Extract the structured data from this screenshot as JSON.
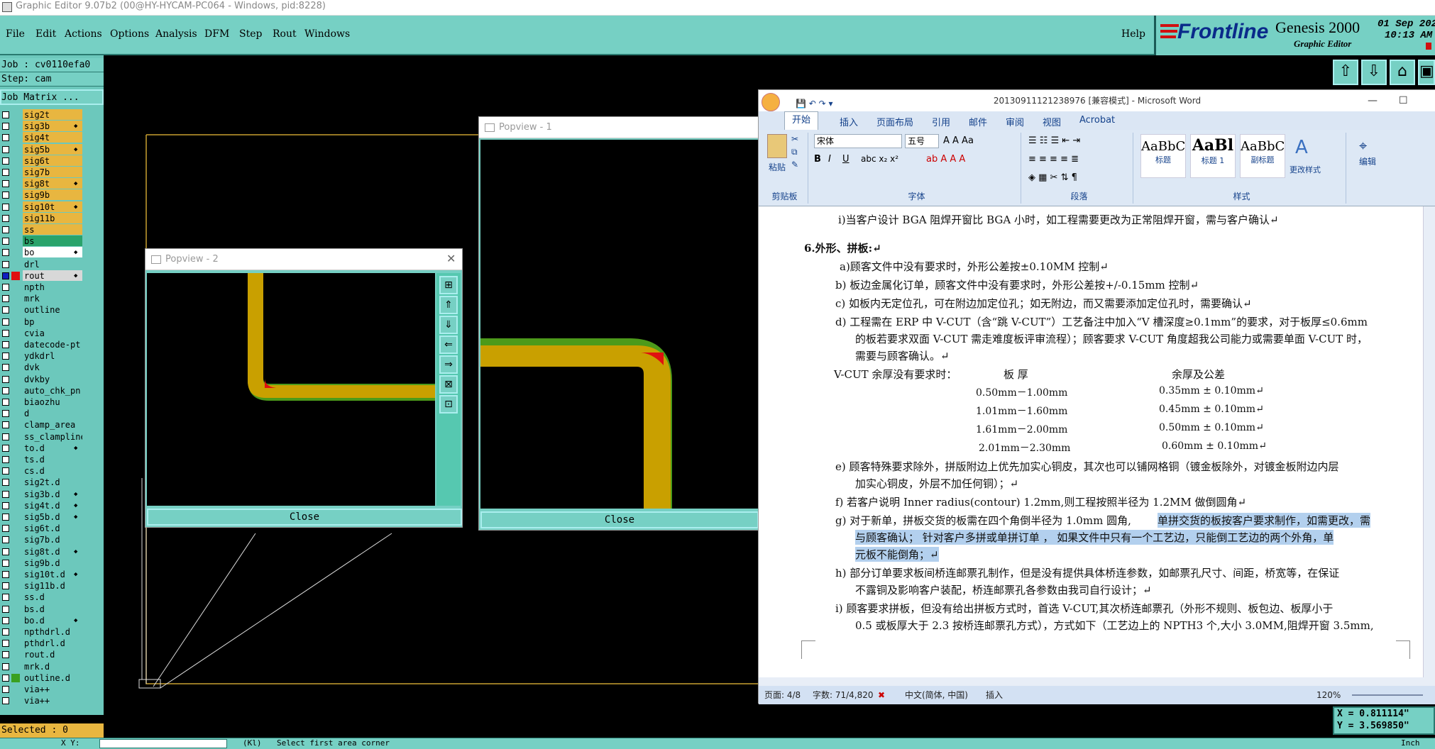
{
  "app": {
    "window_title": "Graphic Editor 9.07b2 (00@HY-HYCAM-PC064 - Windows, pid:8228)",
    "menu": [
      "File",
      "Edit",
      "Actions",
      "Options",
      "Analysis",
      "DFM",
      "Step",
      "Rout",
      "Windows"
    ],
    "help": "Help",
    "brand": "Frontline",
    "product": "Genesis 2000",
    "product_sub": "Graphic Editor",
    "date": "01 Sep 202",
    "time": "10:13 AM"
  },
  "left_panel": {
    "job": "Job : cv0110efa0",
    "step": "Step: cam",
    "job_matrix": "Job Matrix ...",
    "layers": [
      {
        "name": "sig2t",
        "color": "#e8b640",
        "arrow": ""
      },
      {
        "name": "sig3b",
        "color": "#e8b640",
        "arrow": "◆"
      },
      {
        "name": "sig4t",
        "color": "#e8b640",
        "arrow": ""
      },
      {
        "name": "sig5b",
        "color": "#e8b640",
        "arrow": "◆"
      },
      {
        "name": "sig6t",
        "color": "#e8b640",
        "arrow": ""
      },
      {
        "name": "sig7b",
        "color": "#e8b640",
        "arrow": ""
      },
      {
        "name": "sig8t",
        "color": "#e8b640",
        "arrow": "◆"
      },
      {
        "name": "sig9b",
        "color": "#e8b640",
        "arrow": ""
      },
      {
        "name": "sig10t",
        "color": "#e8b640",
        "arrow": "◆"
      },
      {
        "name": "sig11b",
        "color": "#e8b640",
        "arrow": ""
      },
      {
        "name": "ss",
        "color": "#e8b640",
        "arrow": ""
      },
      {
        "name": "bs",
        "color": "#2aa36b",
        "arrow": ""
      },
      {
        "name": "bo",
        "color": "#ffffff",
        "arrow": "◆"
      },
      {
        "name": "drl",
        "color": "#6cc8bc",
        "arrow": ""
      },
      {
        "name": "rout",
        "color": "#d8d8d8",
        "arrow": "◆"
      },
      {
        "name": "npth",
        "color": "#6cc8bc",
        "arrow": ""
      },
      {
        "name": "mrk",
        "color": "#6cc8bc",
        "arrow": ""
      },
      {
        "name": "outline",
        "color": "#6cc8bc",
        "arrow": ""
      },
      {
        "name": "bp",
        "color": "#6cc8bc",
        "arrow": ""
      },
      {
        "name": "cvia",
        "color": "#6cc8bc",
        "arrow": ""
      },
      {
        "name": "datecode-pt",
        "color": "#6cc8bc",
        "arrow": ""
      },
      {
        "name": "ydkdrl",
        "color": "#6cc8bc",
        "arrow": ""
      },
      {
        "name": "dvk",
        "color": "#6cc8bc",
        "arrow": ""
      },
      {
        "name": "dvkby",
        "color": "#6cc8bc",
        "arrow": ""
      },
      {
        "name": "auto_chk_pn",
        "color": "#6cc8bc",
        "arrow": ""
      },
      {
        "name": "biaozhu",
        "color": "#6cc8bc",
        "arrow": ""
      },
      {
        "name": "d",
        "color": "#6cc8bc",
        "arrow": ""
      },
      {
        "name": "clamp_area",
        "color": "#6cc8bc",
        "arrow": ""
      },
      {
        "name": "ss_clampline",
        "color": "#6cc8bc",
        "arrow": ""
      },
      {
        "name": "to.d",
        "color": "#6cc8bc",
        "arrow": "◆"
      },
      {
        "name": "ts.d",
        "color": "#6cc8bc",
        "arrow": ""
      },
      {
        "name": "cs.d",
        "color": "#6cc8bc",
        "arrow": ""
      },
      {
        "name": "sig2t.d",
        "color": "#6cc8bc",
        "arrow": ""
      },
      {
        "name": "sig3b.d",
        "color": "#6cc8bc",
        "arrow": "◆"
      },
      {
        "name": "sig4t.d",
        "color": "#6cc8bc",
        "arrow": "◆"
      },
      {
        "name": "sig5b.d",
        "color": "#6cc8bc",
        "arrow": "◆"
      },
      {
        "name": "sig6t.d",
        "color": "#6cc8bc",
        "arrow": ""
      },
      {
        "name": "sig7b.d",
        "color": "#6cc8bc",
        "arrow": ""
      },
      {
        "name": "sig8t.d",
        "color": "#6cc8bc",
        "arrow": "◆"
      },
      {
        "name": "sig9b.d",
        "color": "#6cc8bc",
        "arrow": ""
      },
      {
        "name": "sig10t.d",
        "color": "#6cc8bc",
        "arrow": "◆"
      },
      {
        "name": "sig11b.d",
        "color": "#6cc8bc",
        "arrow": ""
      },
      {
        "name": "ss.d",
        "color": "#6cc8bc",
        "arrow": ""
      },
      {
        "name": "bs.d",
        "color": "#6cc8bc",
        "arrow": ""
      },
      {
        "name": "bo.d",
        "color": "#6cc8bc",
        "arrow": "◆"
      },
      {
        "name": "npthdrl.d",
        "color": "#6cc8bc",
        "arrow": ""
      },
      {
        "name": "pthdrl.d",
        "color": "#6cc8bc",
        "arrow": ""
      },
      {
        "name": "rout.d",
        "color": "#6cc8bc",
        "arrow": ""
      },
      {
        "name": "mrk.d",
        "color": "#6cc8bc",
        "arrow": ""
      },
      {
        "name": "outline.d",
        "color": "#6cc8bc",
        "arrow": ""
      },
      {
        "name": "via++",
        "color": "#6cc8bc",
        "arrow": ""
      },
      {
        "name": "via++",
        "color": "#6cc8bc",
        "arrow": ""
      }
    ],
    "selected": "Selected : 0"
  },
  "popview1": {
    "title": "Popview - 1",
    "close": "Close"
  },
  "popview2": {
    "title": "Popview - 2",
    "close": "Close"
  },
  "bottom": {
    "prompt": "Select first area corner",
    "mode": "X Y:",
    "tag": "(Kl)",
    "right": "Inch"
  },
  "coords": {
    "x": "X = 0.811114\"",
    "y": "Y = 3.569850\""
  },
  "word": {
    "title": "20130911121238976 [兼容模式] - Microsoft Word",
    "tabs": [
      "开始",
      "插入",
      "页面布局",
      "引用",
      "邮件",
      "审阅",
      "视图",
      "Acrobat"
    ],
    "groups": {
      "clipboard": "剪贴板",
      "font": "字体",
      "paragraph": "段落",
      "styles": "样式",
      "editing": "编辑"
    },
    "paste": "粘贴",
    "font_name": "宋体",
    "font_size": "五号",
    "style_samples": [
      {
        "sample": "AaBbC",
        "label": "标题"
      },
      {
        "sample": "AaBl",
        "label": "标题 1"
      },
      {
        "sample": "AaBbC",
        "label": "副标题"
      }
    ],
    "change_styles": "更改样式",
    "edit": "编辑",
    "doc_lines": [
      "i)当客户设计 BGA 阻焊开窗比 BGA 小时，如工程需要更改为正常阻焊开窗，需与客户确认↵",
      "6.外形、拼板:↵",
      "a)顾客文件中没有要求时，外形公差按±0.10MM 控制↵",
      "b) 板边金属化订单，顾客文件中没有要求时，外形公差按+/-0.15mm 控制↵",
      "c) 如板内无定位孔，可在附边加定位孔；如无附边，而又需要添加定位孔时，需要确认↵",
      "d) 工程需在 ERP 中 V-CUT（含“跳 V-CUT”）工艺备注中加入“V 槽深度≥0.1mm”的要求，对于板厚≤0.6mm",
      "的板若要求双面 V-CUT 需走难度板评审流程）；顾客要求 V-CUT 角度超我公司能力或需要单面 V-CUT 时，",
      "需要与顾客确认。↵",
      "V-CUT 余厚没有要求时：",
      "板    厚",
      "余厚及公差",
      "0.50mm－1.00mm",
      "0.35mm ± 0.10mm↵",
      "1.01mm－1.60mm",
      "0.45mm ± 0.10mm↵",
      "1.61mm－2.00mm",
      "0.50mm ± 0.10mm↵",
      "2.01mm－2.30mm",
      "0.60mm ± 0.10mm↵",
      "e) 顾客特殊要求除外，拼版附边上优先加实心铜皮，其次也可以铺网格铜（镀金板除外，对镀金板附边内层",
      "加实心铜皮，外层不加任何铜）；↵",
      "f) 若客户说明 Inner radius(contour) 1.2mm,则工程按照半径为 1.2MM 做倒圆角↵",
      "g) 对于新单，拼板交货的板需在四个角倒半径为 1.0mm 圆角,",
      "单拼交货的板按客户要求制作，如需更改，需",
      "与顾客确认； 针对客户多拼或单拼订单 ， 如果文件中只有一个工艺边，只能倒工艺边的两个外角，单",
      "元板不能倒角；↵",
      "h) 部分订单要求板间桥连邮票孔制作，但是没有提供具体桥连参数，如邮票孔尺寸、间距，桥宽等，在保证",
      "不露铜及影响客户装配，桥连邮票孔各参数由我司自行设计；↵",
      "i) 顾客要求拼板，但没有给出拼板方式时，首选 V-CUT,其次桥连邮票孔（外形不规则、板包边、板厚小于",
      "0.5 或板厚大于 2.3 按桥连邮票孔方式），方式如下（工艺边上的 NPTH3 个,大小 3.0MM,阻焊开窗 3.5mm,"
    ],
    "status": {
      "page": "页面: 4/8",
      "words": "字数: 71/4,820",
      "lang": "中文(简体, 中国)",
      "mode": "插入",
      "zoom": "120%"
    }
  }
}
